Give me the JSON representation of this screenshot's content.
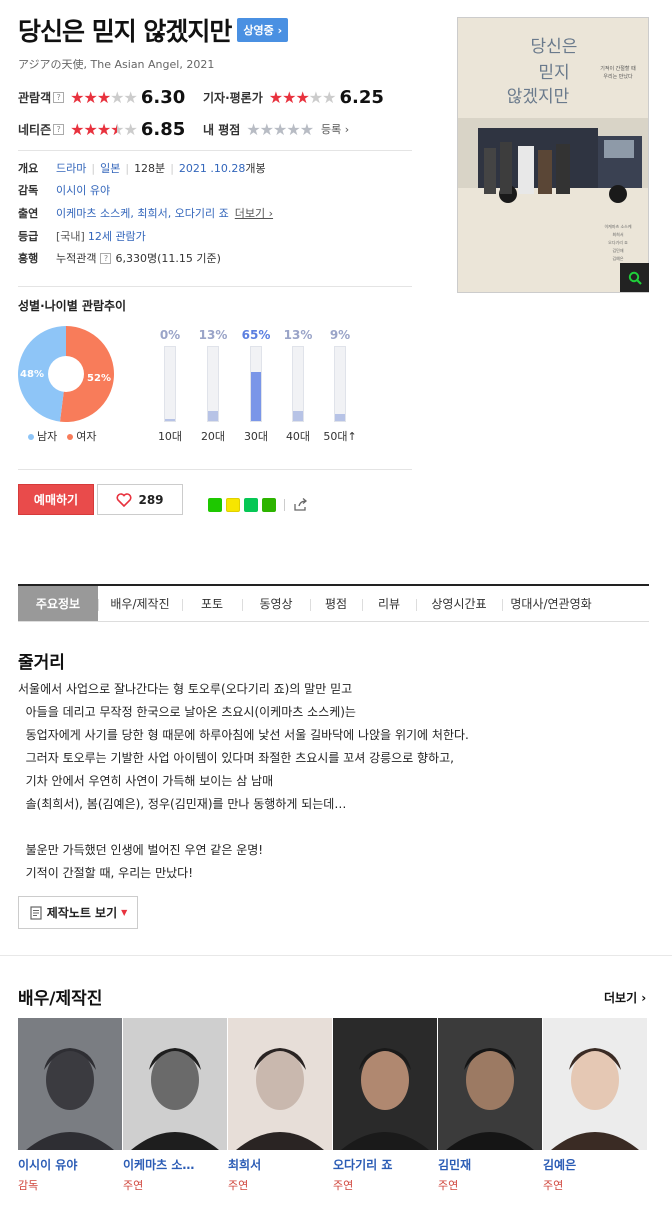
{
  "movie": {
    "title": "당신은 믿지 않겠지만",
    "status_badge": "상영중 ›",
    "subtitle": "アジアの天使, The Asian Angel, 2021",
    "poster_title": "당신은 믿지 않겠지만"
  },
  "ratings": {
    "audience": {
      "label": "관람객",
      "score": "6.30"
    },
    "critic": {
      "label": "기자·평론가",
      "score": "6.25"
    },
    "netizen": {
      "label": "네티즌",
      "score": "6.85"
    },
    "mine": {
      "label": "내 평점",
      "action": "등록 ›"
    }
  },
  "info": {
    "overview": {
      "label": "개요",
      "genre": "드라마",
      "country": "일본",
      "runtime": "128분",
      "release_date": "2021 .10.28",
      "release_suffix": " 개봉"
    },
    "director": {
      "label": "감독",
      "value": "이시이 유야"
    },
    "cast": {
      "label": "출연",
      "value": "이케마츠 소스케, 최희서, 오다기리 죠",
      "more": "더보기 ›"
    },
    "grade": {
      "label": "등급",
      "prefix": "[국내]",
      "value": "12세 관람가"
    },
    "boxoffice": {
      "label": "흥행",
      "key": "누적관객",
      "value": "6,330명(11.15 기준)"
    }
  },
  "stats": {
    "title": "성별·나이별 관람추이",
    "gender": {
      "male": {
        "label": "남자",
        "pct": "48%",
        "value": 48,
        "color": "#8ec5f7"
      },
      "female": {
        "label": "여자",
        "pct": "52%",
        "value": 52,
        "color": "#f87c5a"
      }
    },
    "ages": [
      {
        "label": "10대",
        "pct": "0%",
        "value": 0
      },
      {
        "label": "20대",
        "pct": "13%",
        "value": 13
      },
      {
        "label": "30대",
        "pct": "65%",
        "value": 65,
        "highlight": true
      },
      {
        "label": "40대",
        "pct": "13%",
        "value": 13
      },
      {
        "label": "50대↑",
        "pct": "9%",
        "value": 9
      }
    ]
  },
  "actions": {
    "buy": "예매하기",
    "like_count": "289"
  },
  "tabs": [
    "주요정보",
    "배우/제작진",
    "포토",
    "동영상",
    "평점",
    "리뷰",
    "상영시간표",
    "명대사/연관영화"
  ],
  "synopsis": {
    "heading": "줄거리",
    "text": "서울에서 사업으로 잘나간다는 형 토오루(오다기리 죠)의 말만 믿고\n  아들을 데리고 무작정 한국으로 날아온 츠요시(이케마츠 소스케)는\n  동업자에게 사기를 당한 형 때문에 하루아침에 낯선 서울 길바닥에 나앉을 위기에 처한다.\n  그러자 토오루는 기발한 사업 아이템이 있다며 좌절한 츠요시를 꼬셔 강릉으로 향하고,\n  기차 안에서 우연히 사연이 가득해 보이는 삼 남매\n  솔(최희서), 봄(김예은), 정우(김민재)를 만나 동행하게 되는데…\n\n  불운만 가득했던 인생에 벌어진 우연 같은 운명!\n  기적이 간절할 때, 우리는 만났다!",
    "note_button": "제작노트 보기"
  },
  "cast_section": {
    "heading": "배우/제작진",
    "more": "더보기 ›",
    "people": [
      {
        "name": "이시이 유야",
        "role": "감독"
      },
      {
        "name": "이케마츠 소…",
        "role": "주연"
      },
      {
        "name": "최희서",
        "role": "주연"
      },
      {
        "name": "오다기리 죠",
        "role": "주연"
      },
      {
        "name": "김민재",
        "role": "주연"
      },
      {
        "name": "김예은",
        "role": "주연"
      }
    ]
  }
}
